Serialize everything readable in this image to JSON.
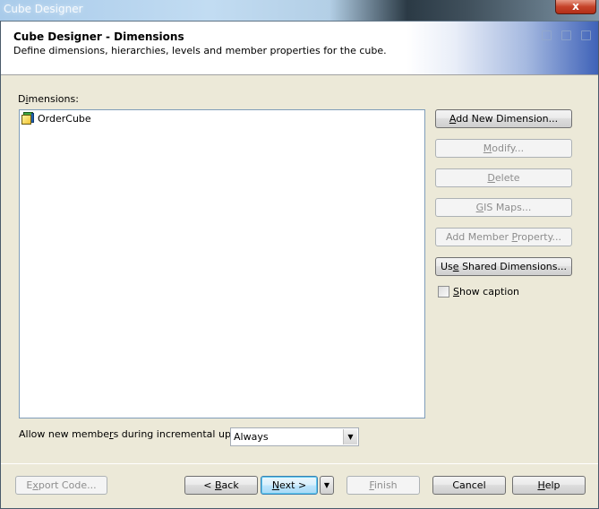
{
  "window": {
    "title": "Cube Designer",
    "close_label": "x"
  },
  "header": {
    "title": "Cube Designer - Dimensions",
    "subtitle": "Define dimensions, hierarchies, levels and member properties for the cube."
  },
  "dimensions": {
    "label_pre": "D",
    "label_u": "i",
    "label_post": "mensions:",
    "items": [
      {
        "label": "OrderCube",
        "icon": "cube-icon"
      }
    ]
  },
  "actions": {
    "add_new_dimension": {
      "pre": "",
      "u": "A",
      "post": "dd New Dimension...",
      "enabled": true
    },
    "modify": {
      "pre": "",
      "u": "M",
      "post": "odify...",
      "enabled": false
    },
    "delete": {
      "pre": "",
      "u": "D",
      "post": "elete",
      "enabled": false
    },
    "gis_maps": {
      "pre": "",
      "u": "G",
      "post": "IS Maps...",
      "enabled": false
    },
    "add_member_property": {
      "pre": "Add Member ",
      "u": "P",
      "post": "roperty...",
      "enabled": false
    },
    "use_shared_dimensions": {
      "pre": "Us",
      "u": "e",
      "post": " Shared Dimensions...",
      "enabled": true
    }
  },
  "show_caption": {
    "u": "S",
    "post": "how caption",
    "checked": false
  },
  "incremental": {
    "label_pre": "Allow new membe",
    "label_u": "r",
    "label_post": "s during incremental update:",
    "selected": "Always"
  },
  "footer": {
    "export_code": {
      "pre": "E",
      "u": "x",
      "post": "port Code...",
      "enabled": false
    },
    "back": {
      "pre": "< ",
      "u": "B",
      "post": "ack",
      "enabled": true
    },
    "next": {
      "pre": "",
      "u": "N",
      "post": "ext >",
      "enabled": true
    },
    "finish": {
      "pre": "",
      "u": "F",
      "post": "inish",
      "enabled": false
    },
    "cancel": {
      "label": "Cancel",
      "enabled": true
    },
    "help": {
      "pre": "",
      "u": "H",
      "post": "elp",
      "enabled": true
    }
  }
}
